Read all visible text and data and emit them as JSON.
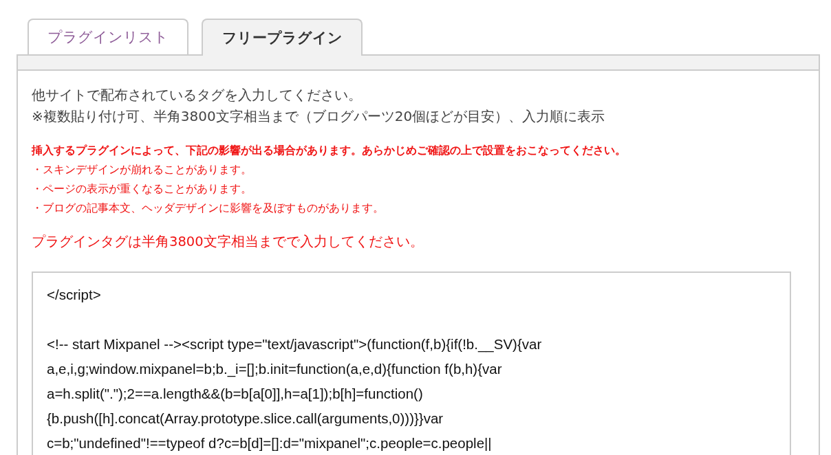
{
  "tabs": [
    {
      "label": "プラグインリスト",
      "selected": false
    },
    {
      "label": "フリープラグイン",
      "selected": true
    }
  ],
  "description": [
    "他サイトで配布されているタグを入力してください。",
    "※複数貼り付け可、半角3800文字相当まで（ブログパーツ20個ほどが目安）、入力順に表示"
  ],
  "warning": {
    "title": "挿入するプラグインによって、下記の影響が出る場合があります。あらかじめご確認の上で設置をおこなってください。",
    "items": [
      "・スキンデザインが崩れることがあります。",
      "・ページの表示が重くなることがあります。",
      "・ブログの記事本文、ヘッダデザインに影響を及ぼすものがあります。"
    ]
  },
  "notice": "プラグインタグは半角3800文字相当までで入力してください。",
  "tag_input": {
    "paragraphs": [
      [
        "</script>"
      ],
      [
        "<!-- start Mixpanel --><script type=\"text/javascript\">(function(f,b){if(!b.__SV){var",
        "a,e,i,g;window.mixpanel=b;b._i=[];b.init=function(a,e,d){function f(b,h){var",
        "a=h.split(\".\");2==a.length&&(b=b[a[0]],h=a[1]);b[h]=function()",
        "{b.push([h].concat(Array.prototype.slice.call(arguments,0)))}}var",
        "c=b;\"undefined\"!==typeof d?c=b[d]=[]:d=\"mixpanel\";c.people=c.people||"
      ]
    ]
  }
}
